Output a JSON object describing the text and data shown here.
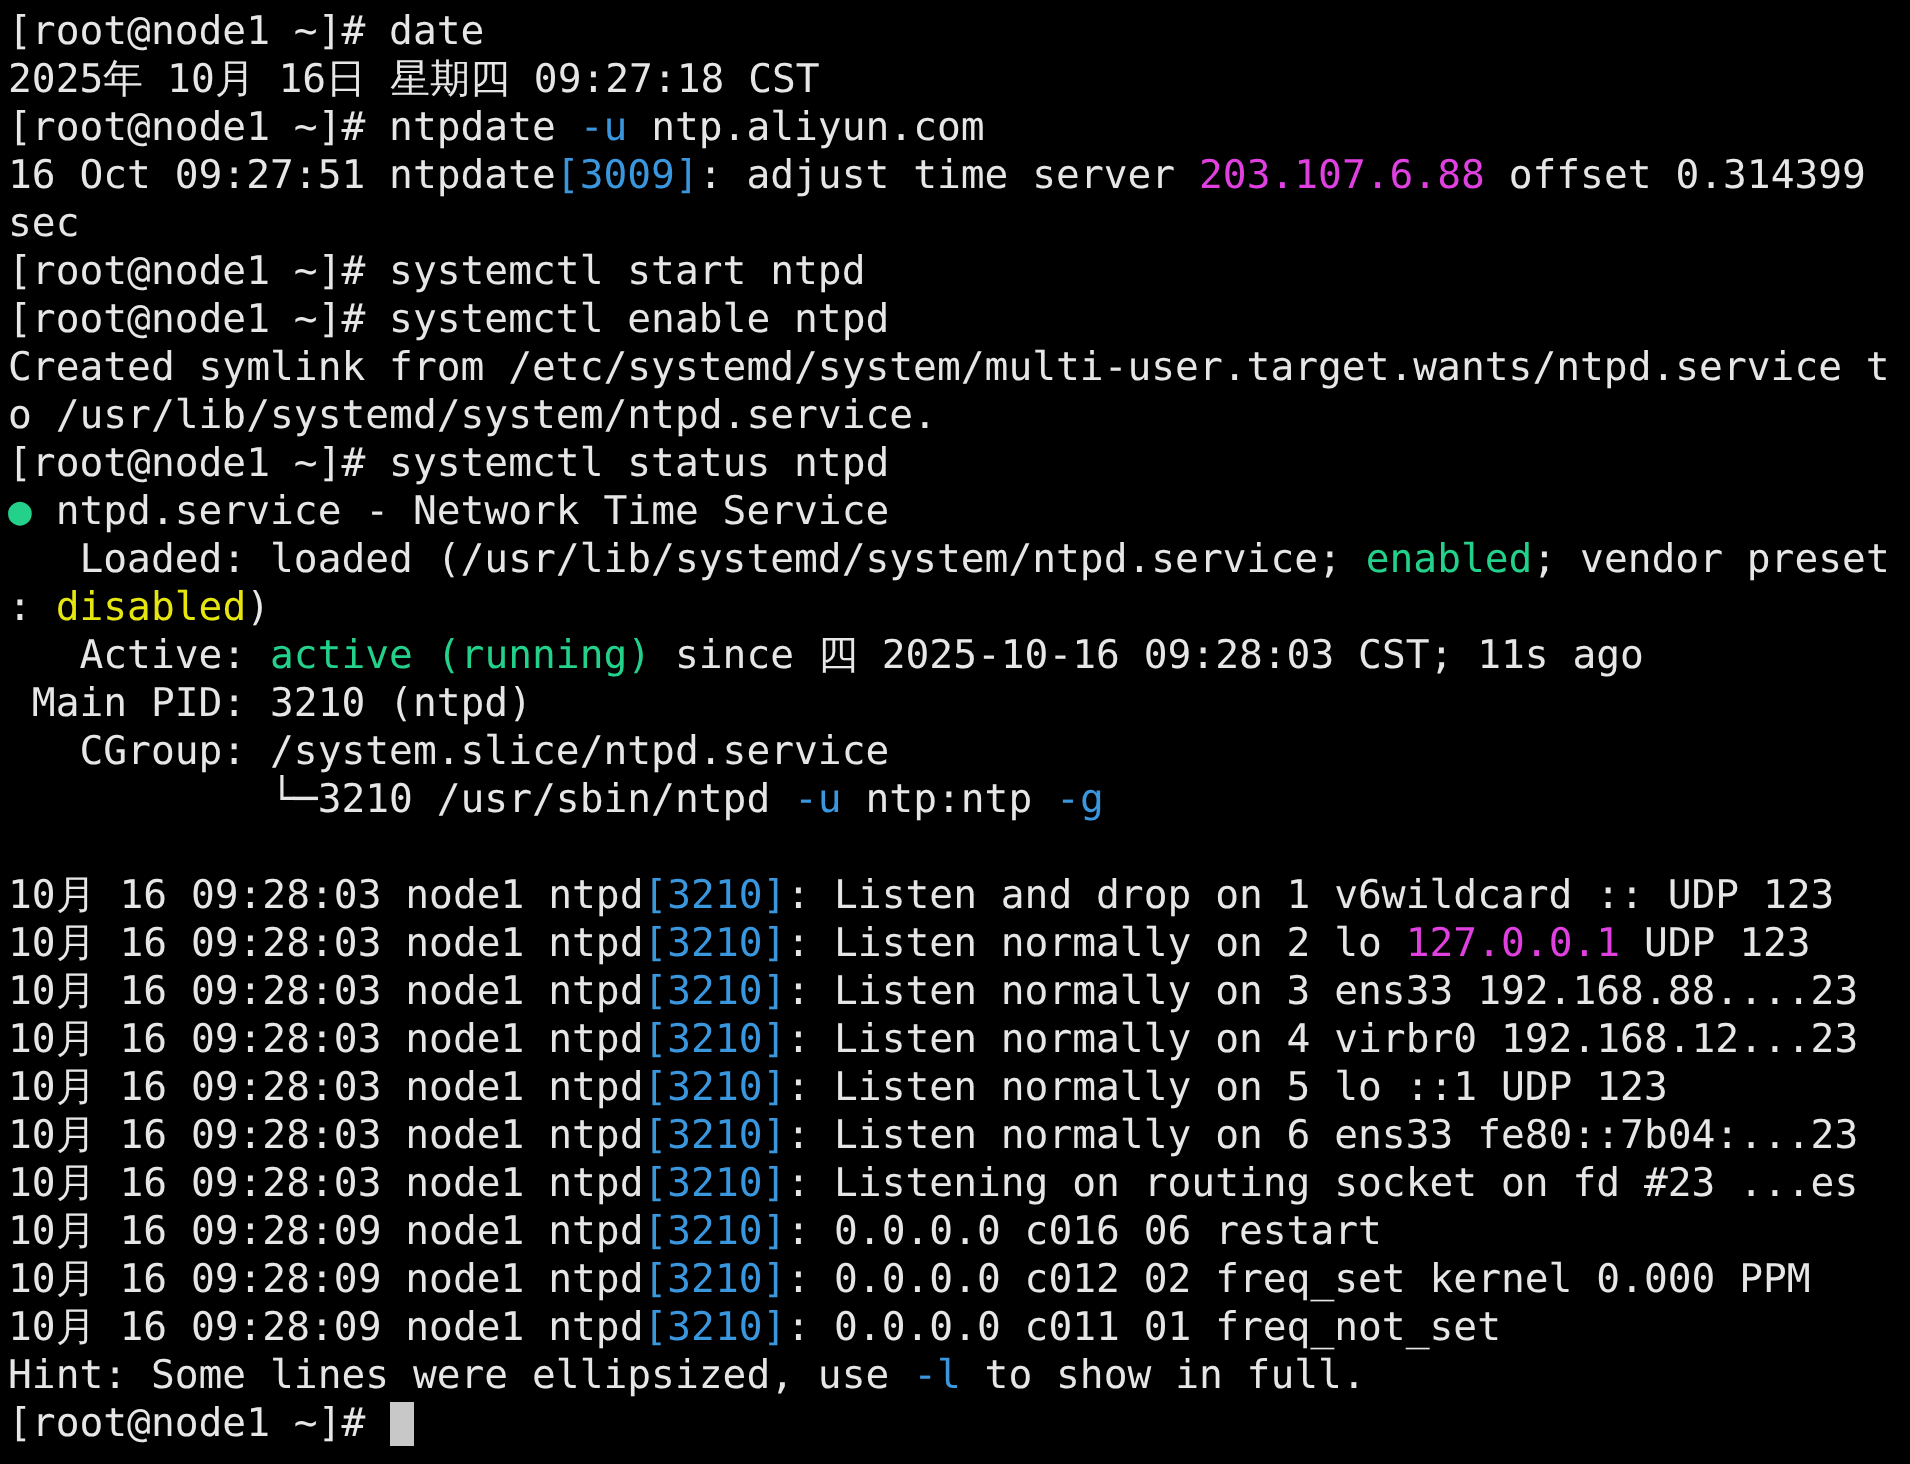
{
  "lines": [
    {
      "kind": "text",
      "segments": [
        {
          "text": "[root@node1 ~]# date"
        }
      ]
    },
    {
      "kind": "text",
      "segments": [
        {
          "text": "2025年 10月 16日 星期四 09:27:18 CST"
        }
      ]
    },
    {
      "kind": "text",
      "segments": [
        {
          "text": "[root@node1 ~]# ntpdate "
        },
        {
          "text": "-u",
          "color": "#3a96dd"
        },
        {
          "text": " ntp.aliyun.com"
        }
      ]
    },
    {
      "kind": "text",
      "segments": [
        {
          "text": "16 Oct 09:27:51 ntpdate"
        },
        {
          "text": "[3009]",
          "color": "#3a96dd"
        },
        {
          "text": ": adjust time server "
        },
        {
          "text": "203.107.6.88",
          "color": "#e040e0"
        },
        {
          "text": " offset 0.314399"
        }
      ]
    },
    {
      "kind": "text",
      "segments": [
        {
          "text": "sec"
        }
      ]
    },
    {
      "kind": "text",
      "segments": [
        {
          "text": "[root@node1 ~]# systemctl start ntpd"
        }
      ]
    },
    {
      "kind": "text",
      "segments": [
        {
          "text": "[root@node1 ~]# systemctl enable ntpd"
        }
      ]
    },
    {
      "kind": "text",
      "segments": [
        {
          "text": "Created symlink from /etc/systemd/system/multi-user.target.wants/ntpd.service t"
        }
      ]
    },
    {
      "kind": "text",
      "segments": [
        {
          "text": "o /usr/lib/systemd/system/ntpd.service."
        }
      ]
    },
    {
      "kind": "text",
      "segments": [
        {
          "text": "[root@node1 ~]# systemctl status ntpd"
        }
      ]
    },
    {
      "kind": "text",
      "segments": [
        {
          "text": "●",
          "color": "#23d18b"
        },
        {
          "text": " ntpd.service - Network Time Service"
        }
      ]
    },
    {
      "kind": "text",
      "segments": [
        {
          "text": "   Loaded: loaded (/usr/lib/systemd/system/ntpd.service; "
        },
        {
          "text": "enabled",
          "color": "#23d18b"
        },
        {
          "text": "; vendor preset"
        }
      ]
    },
    {
      "kind": "text",
      "segments": [
        {
          "text": ": "
        },
        {
          "text": "disabled",
          "color": "#e5e510"
        },
        {
          "text": ")"
        }
      ]
    },
    {
      "kind": "text",
      "segments": [
        {
          "text": "   Active: "
        },
        {
          "text": "active (running)",
          "color": "#23d18b"
        },
        {
          "text": " since 四 2025-10-16 09:28:03 CST; 11s ago"
        }
      ]
    },
    {
      "kind": "text",
      "segments": [
        {
          "text": " Main PID: 3210 (ntpd)"
        }
      ]
    },
    {
      "kind": "text",
      "segments": [
        {
          "text": "   CGroup: /system.slice/ntpd.service"
        }
      ]
    },
    {
      "kind": "text",
      "segments": [
        {
          "text": "           └─3210 /usr/sbin/ntpd "
        },
        {
          "text": "-u",
          "color": "#3a96dd"
        },
        {
          "text": " ntp:ntp "
        },
        {
          "text": "-g",
          "color": "#3a96dd"
        }
      ]
    },
    {
      "kind": "blank"
    },
    {
      "kind": "text",
      "segments": [
        {
          "text": "10月 16 09:28:03 node1 ntpd"
        },
        {
          "text": "[3210]",
          "color": "#3a96dd"
        },
        {
          "text": ": Listen and drop on 1 v6wildcard :: UDP 123"
        }
      ]
    },
    {
      "kind": "text",
      "segments": [
        {
          "text": "10月 16 09:28:03 node1 ntpd"
        },
        {
          "text": "[3210]",
          "color": "#3a96dd"
        },
        {
          "text": ": Listen normally on 2 lo "
        },
        {
          "text": "127.0.0.1",
          "color": "#e040e0"
        },
        {
          "text": " UDP 123"
        }
      ]
    },
    {
      "kind": "text",
      "segments": [
        {
          "text": "10月 16 09:28:03 node1 ntpd"
        },
        {
          "text": "[3210]",
          "color": "#3a96dd"
        },
        {
          "text": ": Listen normally on 3 ens33 192.168.88....23"
        }
      ]
    },
    {
      "kind": "text",
      "segments": [
        {
          "text": "10月 16 09:28:03 node1 ntpd"
        },
        {
          "text": "[3210]",
          "color": "#3a96dd"
        },
        {
          "text": ": Listen normally on 4 virbr0 192.168.12...23"
        }
      ]
    },
    {
      "kind": "text",
      "segments": [
        {
          "text": "10月 16 09:28:03 node1 ntpd"
        },
        {
          "text": "[3210]",
          "color": "#3a96dd"
        },
        {
          "text": ": Listen normally on 5 lo ::1 UDP 123"
        }
      ]
    },
    {
      "kind": "text",
      "segments": [
        {
          "text": "10月 16 09:28:03 node1 ntpd"
        },
        {
          "text": "[3210]",
          "color": "#3a96dd"
        },
        {
          "text": ": Listen normally on 6 ens33 fe80::7b04:...23"
        }
      ]
    },
    {
      "kind": "text",
      "segments": [
        {
          "text": "10月 16 09:28:03 node1 ntpd"
        },
        {
          "text": "[3210]",
          "color": "#3a96dd"
        },
        {
          "text": ": Listening on routing socket on fd #23 ...es"
        }
      ]
    },
    {
      "kind": "text",
      "segments": [
        {
          "text": "10月 16 09:28:09 node1 ntpd"
        },
        {
          "text": "[3210]",
          "color": "#3a96dd"
        },
        {
          "text": ": 0.0.0.0 c016 06 restart"
        }
      ]
    },
    {
      "kind": "text",
      "segments": [
        {
          "text": "10月 16 09:28:09 node1 ntpd"
        },
        {
          "text": "[3210]",
          "color": "#3a96dd"
        },
        {
          "text": ": 0.0.0.0 c012 02 freq_set kernel 0.000 PPM"
        }
      ]
    },
    {
      "kind": "text",
      "segments": [
        {
          "text": "10月 16 09:28:09 node1 ntpd"
        },
        {
          "text": "[3210]",
          "color": "#3a96dd"
        },
        {
          "text": ": 0.0.0.0 c011 01 freq_not_set"
        }
      ]
    },
    {
      "kind": "text",
      "segments": [
        {
          "text": "Hint: Some lines were ellipsized, use "
        },
        {
          "text": "-l",
          "color": "#3a96dd"
        },
        {
          "text": " to show in full."
        }
      ]
    },
    {
      "kind": "prompt",
      "segments": [
        {
          "text": "[root@node1 ~]# "
        }
      ]
    }
  ]
}
